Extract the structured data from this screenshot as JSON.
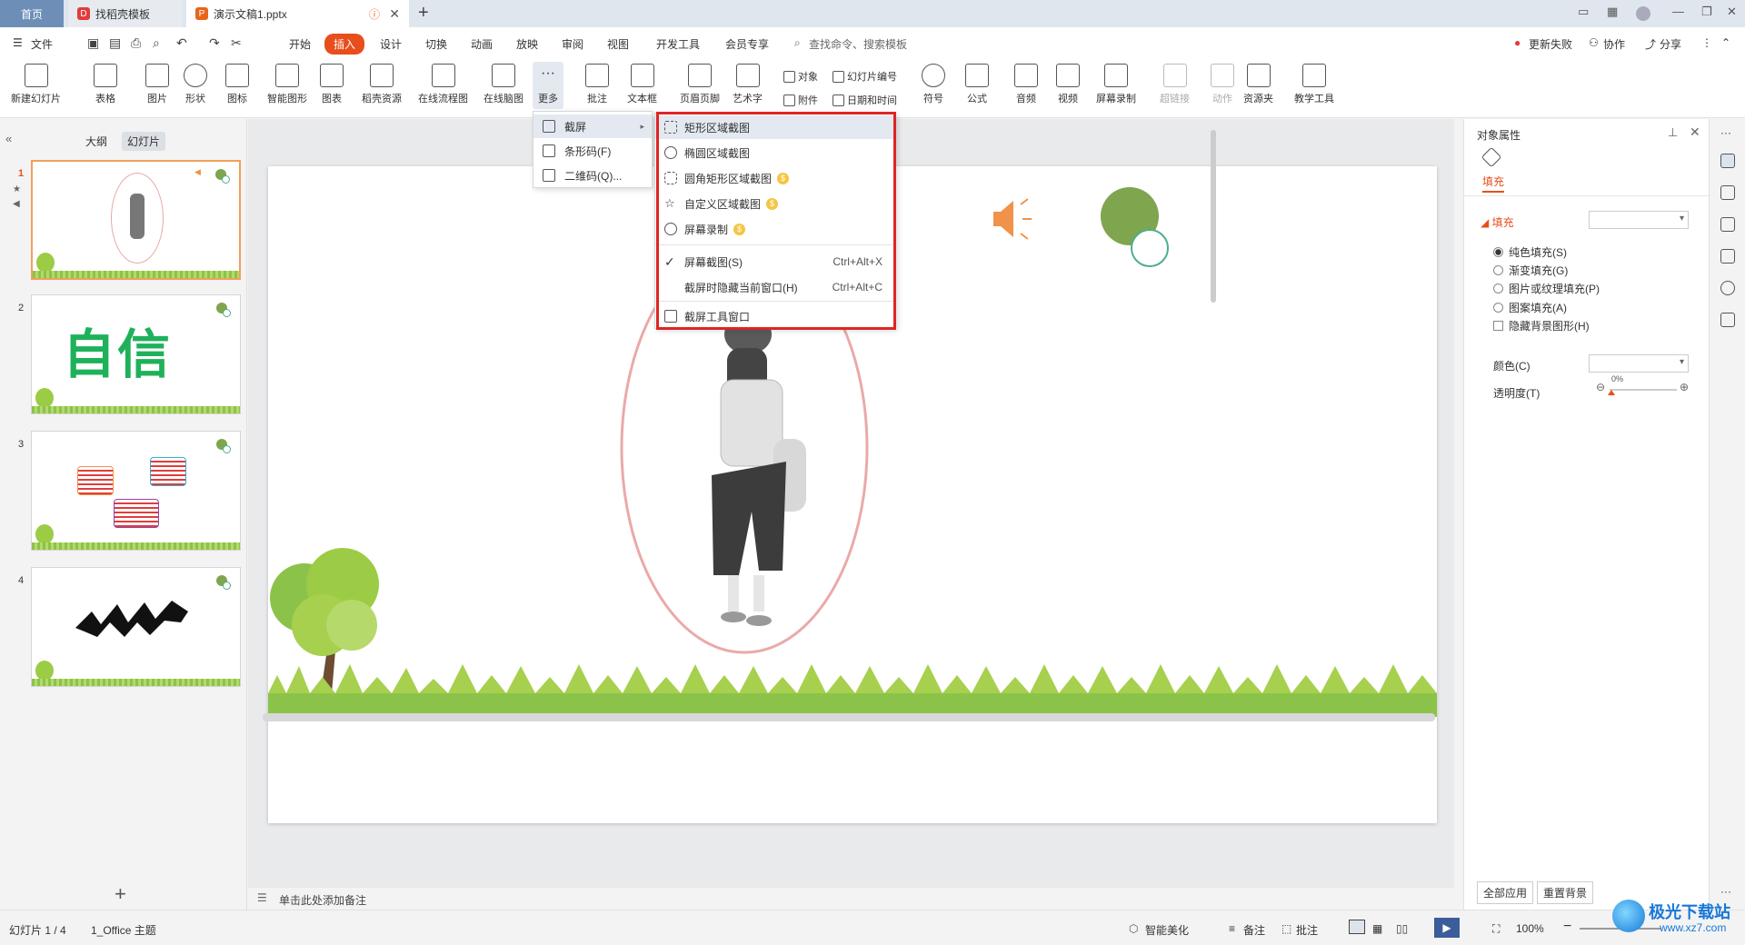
{
  "tabs": {
    "home": "首页",
    "template": "找稻壳模板",
    "doc": "演示文稿1.pptx"
  },
  "menu": {
    "file": "文件",
    "items": [
      "开始",
      "插入",
      "设计",
      "切换",
      "动画",
      "放映",
      "审阅",
      "视图",
      "开发工具",
      "会员专享"
    ],
    "active": "插入",
    "search": "查找命令、搜索模板",
    "right": [
      "更新失败",
      "协作",
      "分享"
    ]
  },
  "ribbon": {
    "new_slide": "新建幻灯片",
    "table": "表格",
    "picture": "图片",
    "shape": "形状",
    "icon": "图标",
    "smart_graphic": "智能图形",
    "chart": "图表",
    "docer": "稻壳资源",
    "flowchart": "在线流程图",
    "mindmap": "在线脑图",
    "more": "更多",
    "comment": "批注",
    "textbox": "文本框",
    "header_footer": "页眉页脚",
    "wordart": "艺术字",
    "object": "对象",
    "attachment": "附件",
    "slide_number": "幻灯片编号",
    "date_time": "日期和时间",
    "symbol": "符号",
    "formula": "公式",
    "audio": "音频",
    "video": "视频",
    "screen_record": "屏幕录制",
    "hyperlink": "超链接",
    "action": "动作",
    "resource": "资源夹",
    "teaching": "教学工具"
  },
  "more_menu": {
    "items": [
      "截屏",
      "条形码(F)",
      "二维码(Q)..."
    ]
  },
  "screenshot_menu": {
    "items": [
      {
        "label": "矩形区域截图",
        "vip": false
      },
      {
        "label": "椭圆区域截图",
        "vip": false
      },
      {
        "label": "圆角矩形区域截图",
        "vip": true
      },
      {
        "label": "自定义区域截图",
        "vip": true
      },
      {
        "label": "屏幕录制",
        "vip": true
      }
    ],
    "screen_capture": "屏幕截图(S)",
    "screen_capture_key": "Ctrl+Alt+X",
    "hide_window": "截屏时隐藏当前窗口(H)",
    "hide_window_key": "Ctrl+Alt+C",
    "tool_window": "截屏工具窗口"
  },
  "left_panel": {
    "outline": "大纲",
    "slides": "幻灯片",
    "slide_numbers": [
      "1",
      "2",
      "3",
      "4"
    ],
    "slide2_text": "自信"
  },
  "notes": "单击此处添加备注",
  "right_panel": {
    "title": "对象属性",
    "fill_tab": "填充",
    "fill_header": "填充",
    "options": [
      "纯色填充(S)",
      "渐变填充(G)",
      "图片或纹理填充(P)",
      "图案填充(A)"
    ],
    "hide_bg": "隐藏背景图形(H)",
    "color_label": "颜色(C)",
    "transparency_label": "透明度(T)",
    "transparency_value": "0%",
    "apply_all": "全部应用",
    "reset_bg": "重置背景"
  },
  "status": {
    "slide_info": "幻灯片 1 / 4",
    "theme": "1_Office 主题",
    "beautify": "智能美化",
    "notes": "备注",
    "comments": "批注",
    "zoom": "100%"
  },
  "watermark": {
    "name": "极光下载站",
    "url": "www.xz7.com"
  },
  "colors": {
    "accent": "#e84e1b",
    "highlight_box": "#e02424",
    "slide_green": "#7fa54e",
    "speaker": "#f0924a"
  }
}
